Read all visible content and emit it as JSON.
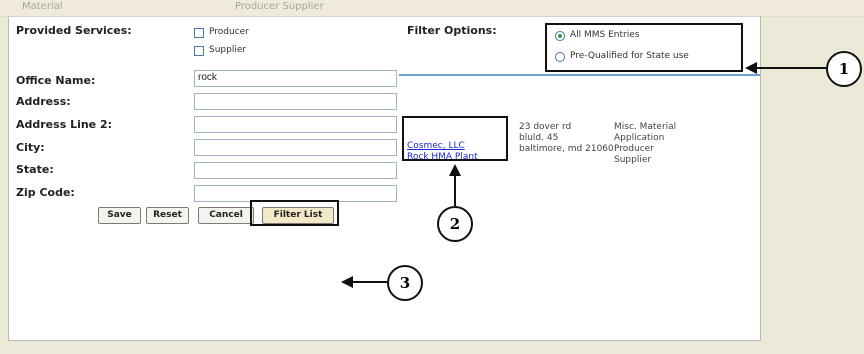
{
  "services": {
    "label": "Provided Services:",
    "options": [
      {
        "label": "Producer",
        "checked": false
      },
      {
        "label": "Supplier",
        "checked": false
      }
    ]
  },
  "filter": {
    "label": "Filter Options:",
    "options": [
      {
        "label": "All MMS Entries",
        "selected": true
      },
      {
        "label": "Pre-Qualified for State use",
        "selected": false
      }
    ]
  },
  "form": {
    "office_name": {
      "label": "Office Name:",
      "value": "rock"
    },
    "address": {
      "label": "Address:",
      "value": ""
    },
    "address2": {
      "label": "Address Line 2:",
      "value": ""
    },
    "city": {
      "label": "City:",
      "value": ""
    },
    "state": {
      "label": "State:",
      "value": ""
    },
    "zip": {
      "label": "Zip Code:",
      "value": ""
    }
  },
  "buttons": {
    "save": "Save",
    "reset": "Reset",
    "cancel": "Cancel",
    "filter_list": "Filter List"
  },
  "result": {
    "links": [
      "Cosmec, LLC",
      "Rock HMA Plant"
    ],
    "address_lines": [
      "23 dover rd",
      "bluld. 45",
      "baltimore, md 21060"
    ],
    "types": [
      "Misc. Material",
      "Application",
      "Producer",
      "Supplier"
    ]
  },
  "callouts": [
    "1",
    "2",
    "3"
  ]
}
